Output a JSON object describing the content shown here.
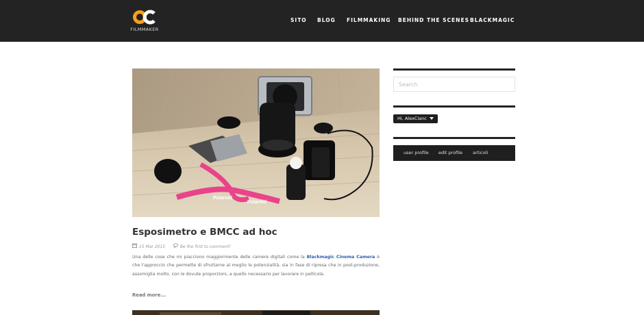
{
  "header": {
    "logo_text": "FILMMAKER",
    "logo_icon": "oc-logo-icon",
    "colors": {
      "background": "#232323",
      "logo_orange": "#f7a11a",
      "logo_white": "#ffffff"
    },
    "nav": [
      {
        "label": "SITO"
      },
      {
        "label": "BLOG"
      },
      {
        "label": "FILMMAKING"
      },
      {
        "label": "BEHIND THE SCENES"
      },
      {
        "label": "BLACKMAGIC"
      }
    ]
  },
  "post": {
    "title": "Esposimetro e BMCC ad hoc",
    "date": "15 Mar 2015",
    "comments": "Be the first to comment!",
    "excerpt_before": "Una delle cose che mi piacciono maggiormente delle camere digitali come la ",
    "excerpt_link": "Blackmagic Cinema Camera",
    "excerpt_after": " è che l'approccio che permette di sfruttarne al meglio le potenzialità, sia in fase di ripresa che in post-produzione, assomiglia molto, con le dovute proporzioni, a quello necessario per lavorare in pellicola.",
    "read_more": "Read more...",
    "image_alt": "camera-photo",
    "strap_text": "Polaroid",
    "colors": {
      "link": "#2a5db0",
      "strap": "#e9438a"
    }
  },
  "sidebar": {
    "search_placeholder": "Search",
    "user_label": "Hi, AlexCianc",
    "user_links": [
      "user profile",
      "edit profile",
      "articoli"
    ]
  }
}
